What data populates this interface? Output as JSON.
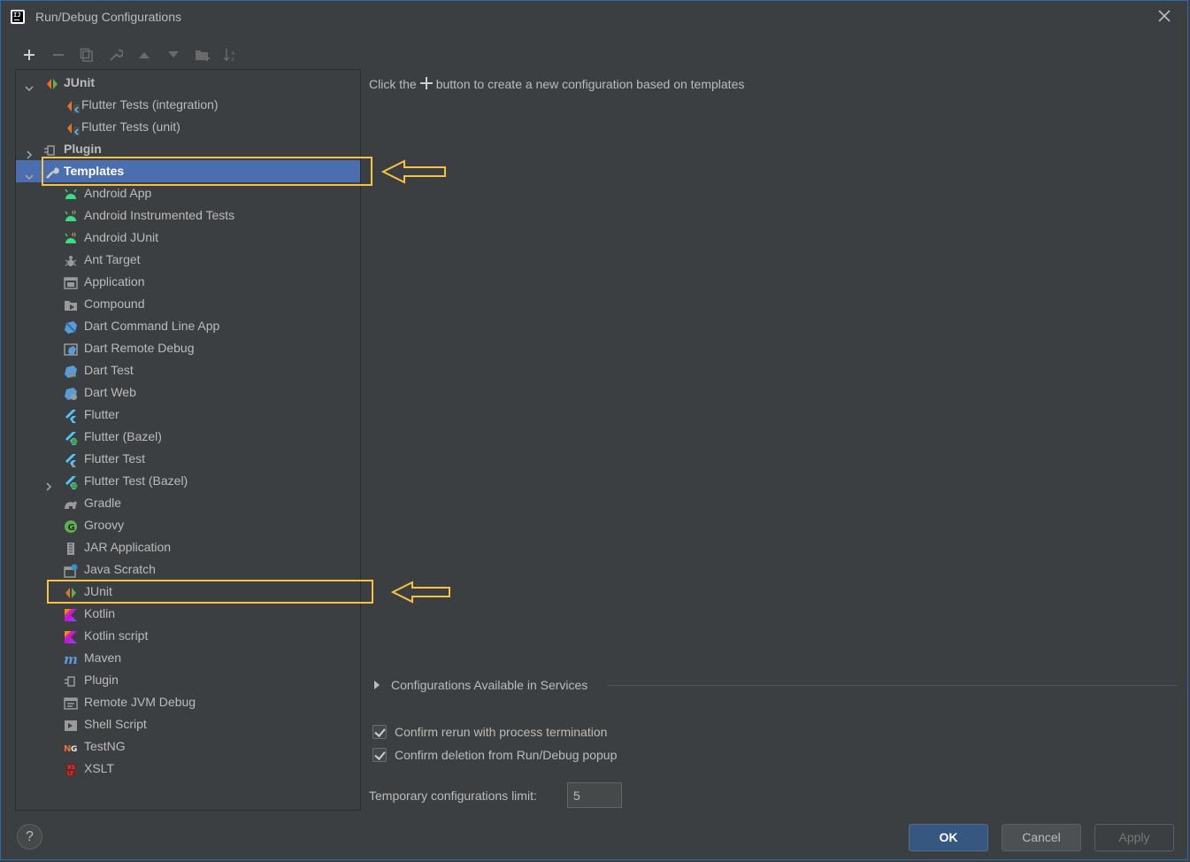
{
  "window": {
    "title": "Run/Debug Configurations",
    "app_icon_text": "IJ"
  },
  "toolbar": {
    "buttons": [
      "add-icon",
      "remove-icon",
      "copy-icon",
      "wrench-icon",
      "move-up-icon",
      "move-down-icon",
      "new-folder-icon",
      "sort-icon"
    ]
  },
  "tree": {
    "items": [
      {
        "label": "JUnit",
        "icon": "junit-icon",
        "bold": true,
        "expanded": true
      },
      {
        "label": "Flutter Tests (integration)",
        "icon": "junit-flutter-icon"
      },
      {
        "label": "Flutter Tests (unit)",
        "icon": "junit-flutter-icon"
      },
      {
        "label": "Plugin",
        "icon": "plugin-icon",
        "bold": true,
        "expanded": false
      },
      {
        "label": "Templates",
        "icon": "wrench-icon",
        "bold": true,
        "expanded": true,
        "selected": true
      },
      {
        "label": "Android App",
        "icon": "android-icon"
      },
      {
        "label": "Android Instrumented Tests",
        "icon": "android-test-icon"
      },
      {
        "label": "Android JUnit",
        "icon": "android-test-icon"
      },
      {
        "label": "Ant Target",
        "icon": "ant-icon"
      },
      {
        "label": "Application",
        "icon": "application-icon"
      },
      {
        "label": "Compound",
        "icon": "compound-icon"
      },
      {
        "label": "Dart Command Line App",
        "icon": "dart-icon"
      },
      {
        "label": "Dart Remote Debug",
        "icon": "dart-remote-icon"
      },
      {
        "label": "Dart Test",
        "icon": "dart-test-icon"
      },
      {
        "label": "Dart Web",
        "icon": "dart-web-icon"
      },
      {
        "label": "Flutter",
        "icon": "flutter-icon"
      },
      {
        "label": "Flutter (Bazel)",
        "icon": "flutter-bazel-icon"
      },
      {
        "label": "Flutter Test",
        "icon": "flutter-test-icon"
      },
      {
        "label": "Flutter Test (Bazel)",
        "icon": "flutter-bazel-icon",
        "expanded": false
      },
      {
        "label": "Gradle",
        "icon": "gradle-icon"
      },
      {
        "label": "Groovy",
        "icon": "groovy-icon"
      },
      {
        "label": "JAR Application",
        "icon": "jar-icon"
      },
      {
        "label": "Java Scratch",
        "icon": "java-scratch-icon"
      },
      {
        "label": "JUnit",
        "icon": "junit-icon"
      },
      {
        "label": "Kotlin",
        "icon": "kotlin-icon"
      },
      {
        "label": "Kotlin script",
        "icon": "kotlin-icon"
      },
      {
        "label": "Maven",
        "icon": "maven-icon"
      },
      {
        "label": "Plugin",
        "icon": "plugin-icon"
      },
      {
        "label": "Remote JVM Debug",
        "icon": "remote-debug-icon"
      },
      {
        "label": "Shell Script",
        "icon": "shell-icon"
      },
      {
        "label": "TestNG",
        "icon": "testng-icon"
      },
      {
        "label": "XSLT",
        "icon": "xslt-icon"
      }
    ]
  },
  "main": {
    "hint_before": "Click the",
    "hint_after": "button to create a new configuration based on templates",
    "services_label": "Configurations Available in Services",
    "confirm_rerun": "Confirm rerun with process termination",
    "confirm_delete": "Confirm deletion from Run/Debug popup",
    "temp_limit_label": "Temporary configurations limit:",
    "temp_limit_value": "5"
  },
  "footer": {
    "help": "?",
    "ok": "OK",
    "cancel": "Cancel",
    "apply": "Apply"
  },
  "colors": {
    "background": "#3c3f41",
    "selection": "#4b6eaf",
    "highlight": "#f5c242",
    "ok_button": "#365880"
  }
}
